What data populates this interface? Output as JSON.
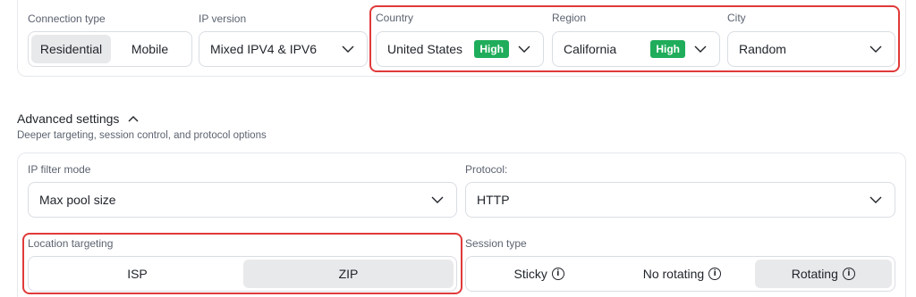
{
  "connection": {
    "label": "Connection type",
    "options": [
      "Residential",
      "Mobile"
    ]
  },
  "ip_version": {
    "label": "IP version",
    "value": "Mixed IPV4 & IPV6"
  },
  "country": {
    "label": "Country",
    "value": "United States",
    "badge": "High"
  },
  "region": {
    "label": "Region",
    "value": "California",
    "badge": "High"
  },
  "city": {
    "label": "City",
    "value": "Random"
  },
  "advanced": {
    "title": "Advanced settings",
    "subtitle": "Deeper targeting, session control, and protocol options"
  },
  "ip_filter": {
    "label": "IP filter mode",
    "value": "Max pool size"
  },
  "protocol": {
    "label": "Protocol:",
    "value": "HTTP"
  },
  "location_targeting": {
    "label": "Location targeting",
    "options": [
      "ISP",
      "ZIP"
    ]
  },
  "session_type": {
    "label": "Session type",
    "options": [
      "Sticky",
      "No rotating",
      "Rotating"
    ]
  },
  "colors": {
    "badge": "#1fad5b",
    "highlight": "#e03a3a",
    "selected": "#e8e9eb"
  }
}
